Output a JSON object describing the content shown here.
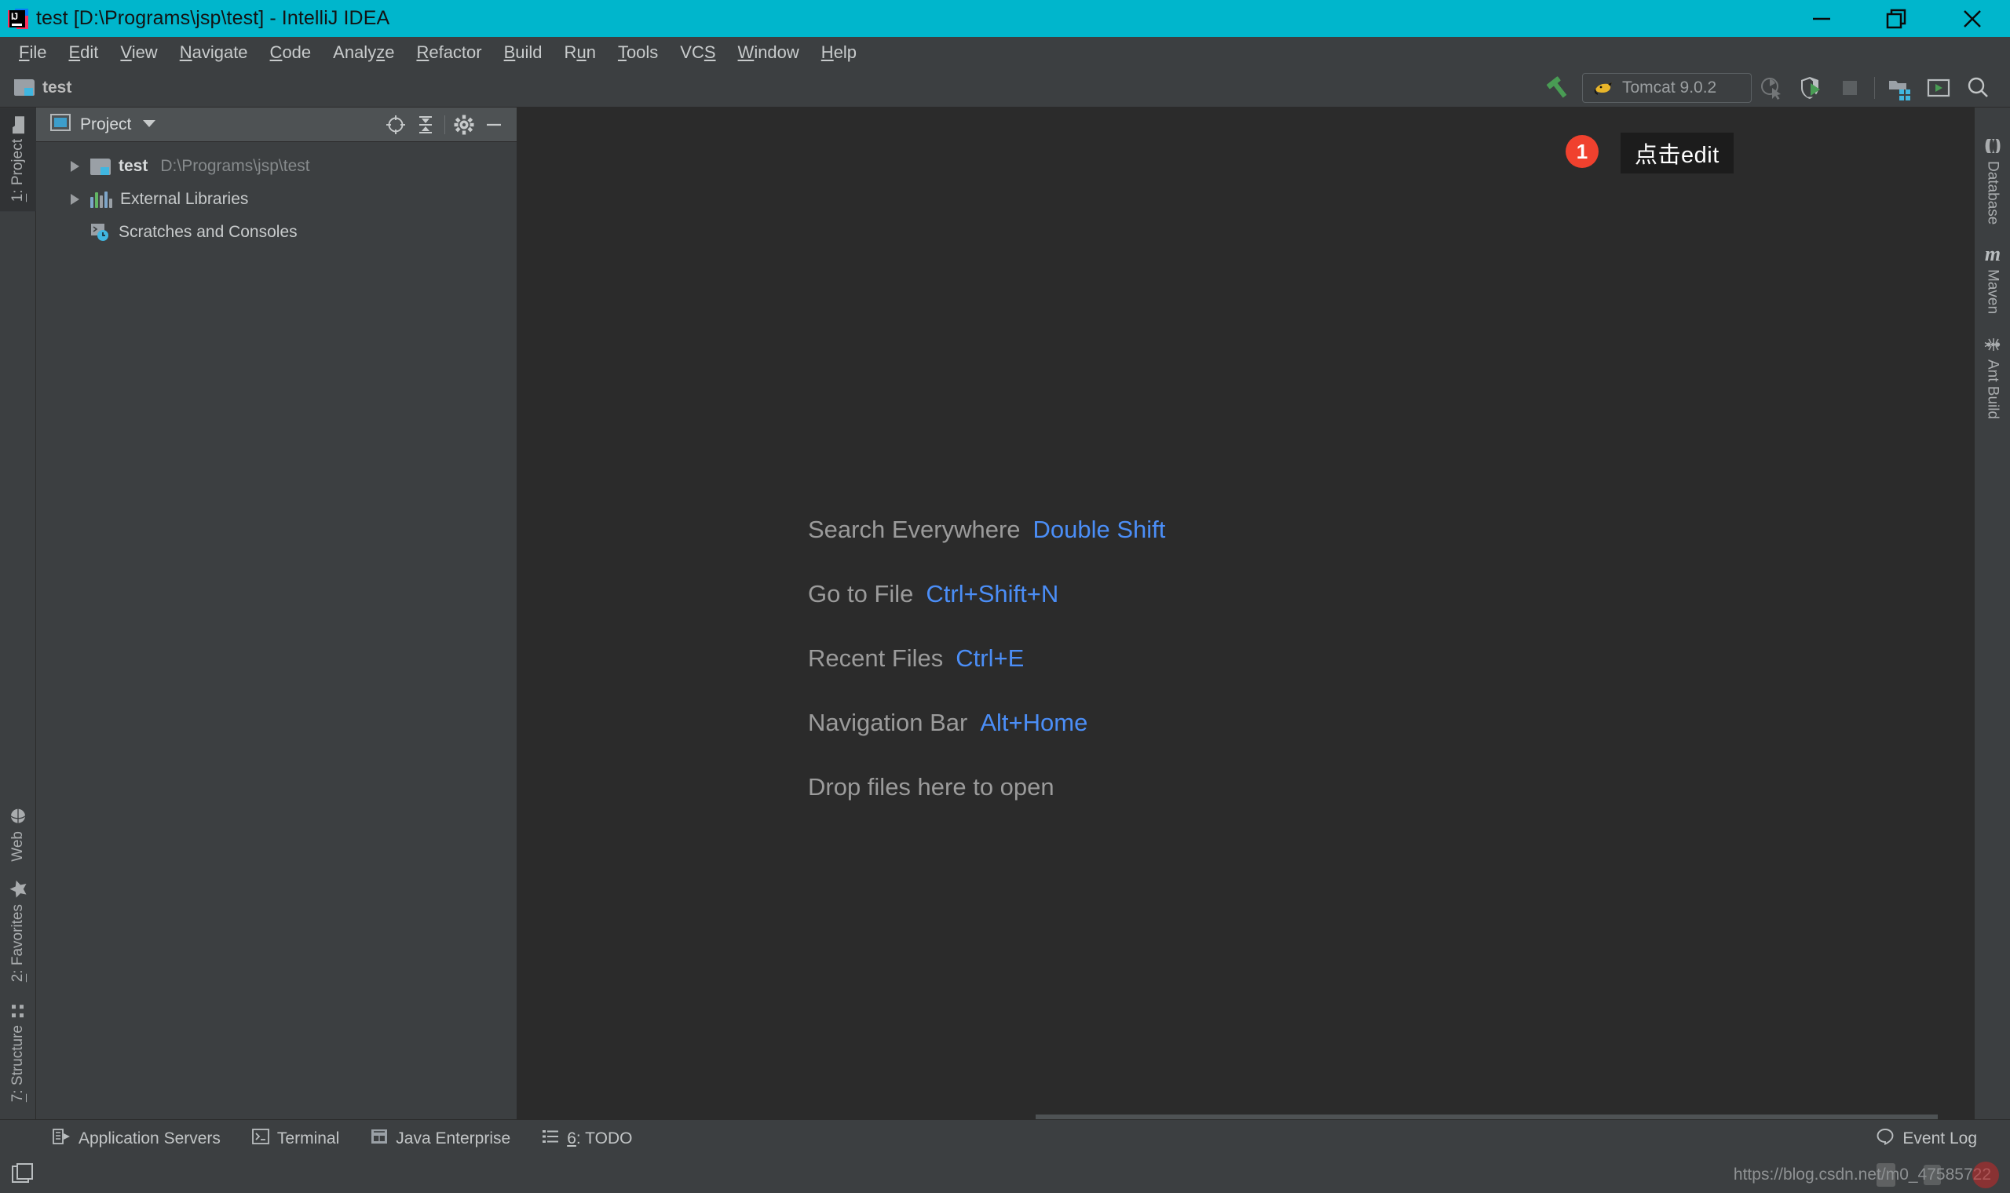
{
  "window": {
    "title": "test [D:\\Programs\\jsp\\test] - IntelliJ IDEA",
    "app_icon": "intellij-idea-logo",
    "minimize": "minimize-icon",
    "maximize": "restore-icon",
    "close": "close-icon",
    "titlebar_color": "#00b6cc"
  },
  "menubar": {
    "items": [
      {
        "mnemonic": "F",
        "rest": "ile"
      },
      {
        "mnemonic": "E",
        "rest": "dit"
      },
      {
        "mnemonic": "V",
        "rest": "iew"
      },
      {
        "mnemonic": "N",
        "rest": "avigate"
      },
      {
        "mnemonic": "C",
        "rest": "ode"
      },
      {
        "pre": "Analy",
        "mnemonic": "z",
        "rest": "e"
      },
      {
        "mnemonic": "R",
        "rest": "efactor"
      },
      {
        "mnemonic": "B",
        "rest": "uild"
      },
      {
        "pre": "R",
        "mnemonic": "u",
        "rest": "n"
      },
      {
        "mnemonic": "T",
        "rest": "ools"
      },
      {
        "pre": "VC",
        "mnemonic": "S",
        "rest": ""
      },
      {
        "mnemonic": "W",
        "rest": "indow"
      },
      {
        "mnemonic": "H",
        "rest": "elp"
      }
    ]
  },
  "toolbar": {
    "breadcrumb": "test",
    "breadcrumb_icon": "project-folder-icon",
    "build_icon": "build-hammer-icon",
    "run_config": {
      "icon": "tomcat-cat-icon",
      "label": "Tomcat 9.0.2"
    },
    "badge": "1",
    "tooltip": "点击edit",
    "buttons": [
      {
        "name": "run-with-coverage-icon",
        "state": "disabled"
      },
      {
        "name": "debug-icon",
        "state": "enabled"
      },
      {
        "name": "stop-icon",
        "state": "disabled"
      },
      {
        "name": "separator",
        "state": "divider"
      },
      {
        "name": "project-structure-icon",
        "state": "enabled"
      },
      {
        "name": "update-application-icon",
        "state": "enabled"
      },
      {
        "name": "search-everywhere-icon",
        "state": "enabled"
      }
    ]
  },
  "left_stripe": {
    "top": [
      {
        "mnemonic": "1",
        "label": ": Project",
        "icon": "project-folder-icon",
        "active": true
      }
    ],
    "bottom": [
      {
        "mnemonic": "",
        "label": "Web",
        "icon": "web-globe-icon",
        "active": false
      },
      {
        "mnemonic": "2",
        "label": ": Favorites",
        "icon": "star-icon",
        "active": false
      },
      {
        "mnemonic": "7",
        "label": ": Structure",
        "icon": "structure-icon",
        "active": false
      }
    ]
  },
  "right_stripe": {
    "items": [
      {
        "label": "Database",
        "icon": "database-icon"
      },
      {
        "label": "Maven",
        "icon": "maven-m-icon"
      },
      {
        "label": "Ant Build",
        "icon": "ant-icon"
      }
    ]
  },
  "project_panel": {
    "header": {
      "view_icon": "project-view-icon",
      "title": "Project",
      "dropdown_icon": "chevron-down-icon",
      "locate_icon": "scroll-from-source-icon",
      "collapse_icon": "collapse-all-icon",
      "settings_icon": "gear-icon",
      "hide_icon": "hide-minus-icon"
    },
    "tree": [
      {
        "name": "test",
        "path": "D:\\Programs\\jsp\\test",
        "icon": "project-folder-icon",
        "expandable": true,
        "bold": true
      },
      {
        "name": "External Libraries",
        "path": "",
        "icon": "libraries-icon",
        "expandable": true,
        "bold": false
      },
      {
        "name": "Scratches and Consoles",
        "path": "",
        "icon": "scratches-icon",
        "expandable": false,
        "bold": false
      }
    ]
  },
  "editor": {
    "hints": [
      {
        "label": "Search Everywhere",
        "key": "Double Shift"
      },
      {
        "label": "Go to File",
        "key": "Ctrl+Shift+N"
      },
      {
        "label": "Recent Files",
        "key": "Ctrl+E"
      },
      {
        "label": "Navigation Bar",
        "key": "Alt+Home"
      },
      {
        "label": "Drop files here to open",
        "key": ""
      }
    ],
    "hint_key_color": "#4b8ef7",
    "hint_label_color": "#9b9b9b",
    "background": "#2b2b2b"
  },
  "statusbar": {
    "items": [
      {
        "icon": "application-servers-icon",
        "mnemonic": "",
        "label": "Application Servers"
      },
      {
        "icon": "terminal-icon",
        "mnemonic": "",
        "label": "Terminal"
      },
      {
        "icon": "java-enterprise-icon",
        "mnemonic": "",
        "label": "Java Enterprise"
      },
      {
        "icon": "todo-icon",
        "mnemonic": "6",
        "label": ": TODO"
      }
    ],
    "event_log": {
      "icon": "event-log-icon",
      "label": "Event Log"
    }
  },
  "footer": {
    "toggle_icon": "toggle-tool-windows-icon",
    "watermark": "https://blog.csdn.net/m0_47585722"
  }
}
